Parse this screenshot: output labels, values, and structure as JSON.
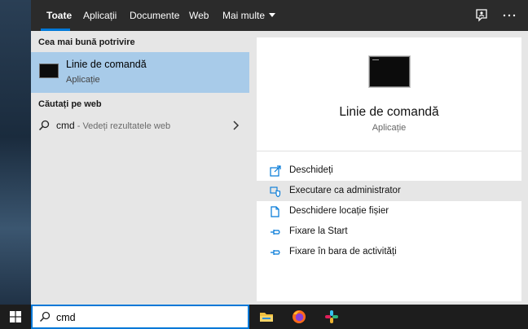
{
  "tabs": [
    {
      "label": "Toate"
    },
    {
      "label": "Aplicații"
    },
    {
      "label": "Documente"
    },
    {
      "label": "Web"
    },
    {
      "label": "Mai multe"
    }
  ],
  "best_match": {
    "heading": "Cea mai bună potrivire",
    "title": "Linie de comandă",
    "subtitle": "Aplicație"
  },
  "web_search": {
    "heading": "Căutați pe web",
    "query": "cmd",
    "hint": " - Vedeți rezultatele web"
  },
  "details": {
    "title": "Linie de comandă",
    "subtitle": "Aplicație",
    "actions": [
      {
        "label": "Deschideți",
        "icon": "open-icon"
      },
      {
        "label": "Executare ca administrator",
        "icon": "shield-icon"
      },
      {
        "label": "Deschidere locație fișier",
        "icon": "file-location-icon"
      },
      {
        "label": "Fixare la Start",
        "icon": "pin-icon"
      },
      {
        "label": "Fixare în bara de activități",
        "icon": "pin-icon"
      }
    ]
  },
  "taskbar": {
    "search_value": "cmd",
    "apps": [
      "file-explorer-icon",
      "firefox-icon",
      "slack-icon"
    ]
  },
  "colors": {
    "accent": "#0078d7",
    "selection": "#a8cbe9",
    "topbar": "#2b2b2b"
  }
}
